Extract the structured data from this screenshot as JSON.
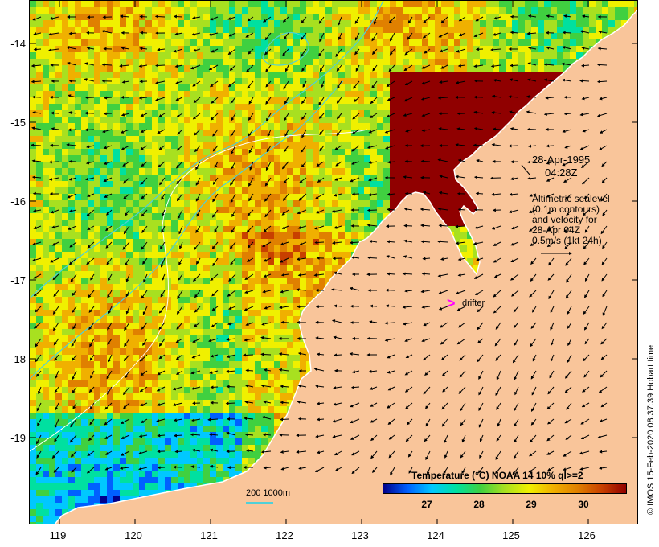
{
  "map": {
    "date": "28-Apr-1995",
    "time": "04:28Z",
    "annotation_lines": [
      "Altimetric sealevel",
      "(0.1m contours)",
      "and velocity for",
      "28-Apr 04Z",
      "0.5m/s (1kt 24h)"
    ],
    "drifter_label": "drifter",
    "drifter_symbol": ">",
    "contour_legend": "200  1000m",
    "timestamp": "© IMOS 15-Feb-2020 08:37:39 Hobart time",
    "legend_title": "Temperature (°C) NOAA 14 10% ql>=2",
    "legend_ticks": [
      "27",
      "28",
      "29",
      "30"
    ],
    "legend_tick_values": [
      27,
      28,
      29,
      30
    ],
    "legend_range": [
      26.2,
      30.9
    ],
    "lat_ticks": [
      "-14",
      "-15",
      "-16",
      "-17",
      "-18",
      "-19"
    ],
    "lon_ticks": [
      "119",
      "120",
      "121",
      "122",
      "123",
      "124",
      "125",
      "126"
    ],
    "lat_values": [
      -14,
      -15,
      -16,
      -17,
      -18,
      -19
    ],
    "lon_values": [
      119,
      120,
      121,
      122,
      123,
      124,
      125,
      126
    ],
    "lat_range": [
      -13.55,
      -20.05
    ],
    "lon_range": [
      118.65,
      126.7
    ],
    "colors": {
      "land": "#f9c59a",
      "coast": "#ffffff",
      "contour": "#4fd0d8",
      "drifter": "#ff00ff",
      "arrow": "#000000"
    },
    "colormap": [
      "#00008b",
      "#0060ff",
      "#00c8ff",
      "#00e0a0",
      "#40d040",
      "#a8e020",
      "#f0f000",
      "#f0b000",
      "#e08000",
      "#c84000",
      "#900000"
    ]
  }
}
